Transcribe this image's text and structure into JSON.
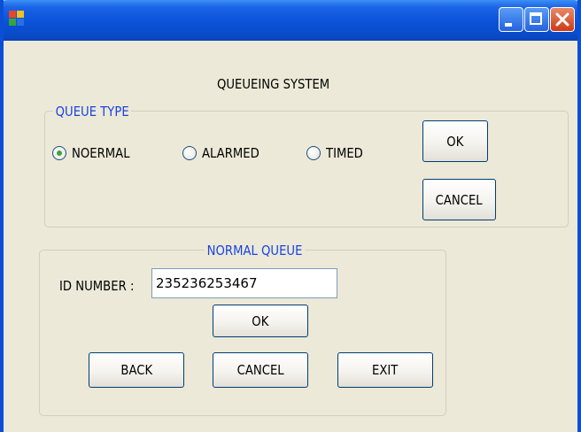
{
  "window": {
    "title": "",
    "buttons": {
      "minimize_icon": "minimize-icon",
      "maximize_icon": "maximize-icon",
      "close_icon": "close-icon"
    },
    "colors": {
      "titlebar": "#0a52d8",
      "body": "#ece9d8",
      "legend_text": "#1a44e0"
    }
  },
  "form": {
    "title": "QUEUEING SYSTEM"
  },
  "queue_type": {
    "legend": "QUEUE TYPE",
    "options": [
      {
        "label": "NOERMAL",
        "selected": true
      },
      {
        "label": "ALARMED",
        "selected": false
      },
      {
        "label": "TIMED",
        "selected": false
      }
    ],
    "ok_label": "OK",
    "cancel_label": "CANCEL"
  },
  "normal_queue": {
    "legend": "NORMAL QUEUE",
    "id_label": "ID NUMBER :",
    "id_value": "235236253467",
    "ok_label": "OK",
    "back_label": "BACK",
    "cancel_label": "CANCEL",
    "exit_label": "EXIT"
  }
}
